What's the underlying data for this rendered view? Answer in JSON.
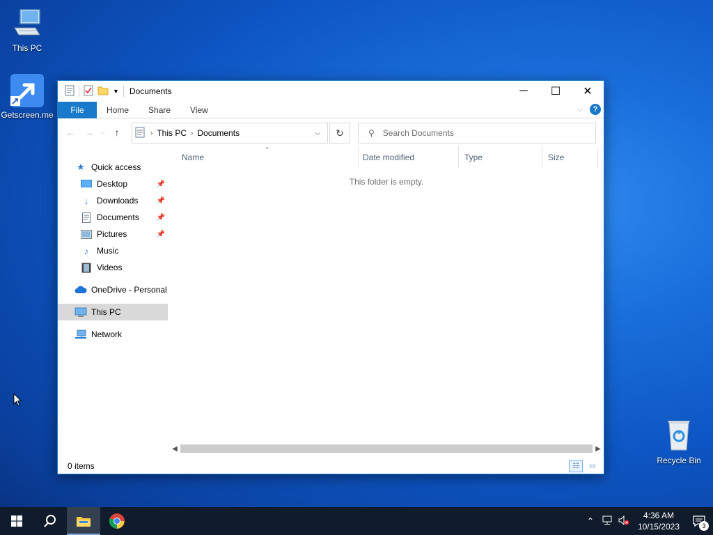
{
  "desktop": {
    "icons": [
      {
        "label": "This PC",
        "icon": "computer-icon"
      },
      {
        "label": "Getscreen.me",
        "icon": "shortcut-arrow-icon"
      },
      {
        "label": "Recycle Bin",
        "icon": "recycle-bin-icon"
      }
    ]
  },
  "window": {
    "title": "Documents",
    "controls": {
      "minimize": "─",
      "maximize": "☐",
      "close": "✕"
    },
    "ribbon": {
      "tabs": [
        {
          "label": "File"
        },
        {
          "label": "Home"
        },
        {
          "label": "Share"
        },
        {
          "label": "View"
        }
      ],
      "help": "?"
    },
    "address": {
      "crumbs": [
        "This PC",
        "Documents"
      ]
    },
    "search": {
      "placeholder": "Search Documents"
    },
    "sidebar": {
      "items": [
        {
          "label": "Quick access",
          "icon": "star-icon",
          "pinned": false
        },
        {
          "label": "Desktop",
          "icon": "desktop-folder-icon",
          "pinned": true
        },
        {
          "label": "Downloads",
          "icon": "download-arrow-icon",
          "pinned": true
        },
        {
          "label": "Documents",
          "icon": "document-icon",
          "pinned": true
        },
        {
          "label": "Pictures",
          "icon": "pictures-icon",
          "pinned": true
        },
        {
          "label": "Music",
          "icon": "music-note-icon",
          "pinned": false
        },
        {
          "label": "Videos",
          "icon": "film-icon",
          "pinned": false
        },
        {
          "label": "OneDrive - Personal",
          "icon": "cloud-icon",
          "pinned": false
        },
        {
          "label": "This PC",
          "icon": "computer-icon",
          "pinned": false,
          "selected": true
        },
        {
          "label": "Network",
          "icon": "network-icon",
          "pinned": false
        }
      ]
    },
    "columns": [
      "Name",
      "Date modified",
      "Type",
      "Size"
    ],
    "empty_message": "This folder is empty.",
    "status": {
      "items_count": "0 items"
    }
  },
  "taskbar": {
    "clock": {
      "time": "4:36 AM",
      "date": "10/15/2023"
    },
    "notification_count": "3"
  },
  "colors": {
    "accent": "#1979ca",
    "taskbar": "#101b2b",
    "selection": "#d9d9d9"
  }
}
